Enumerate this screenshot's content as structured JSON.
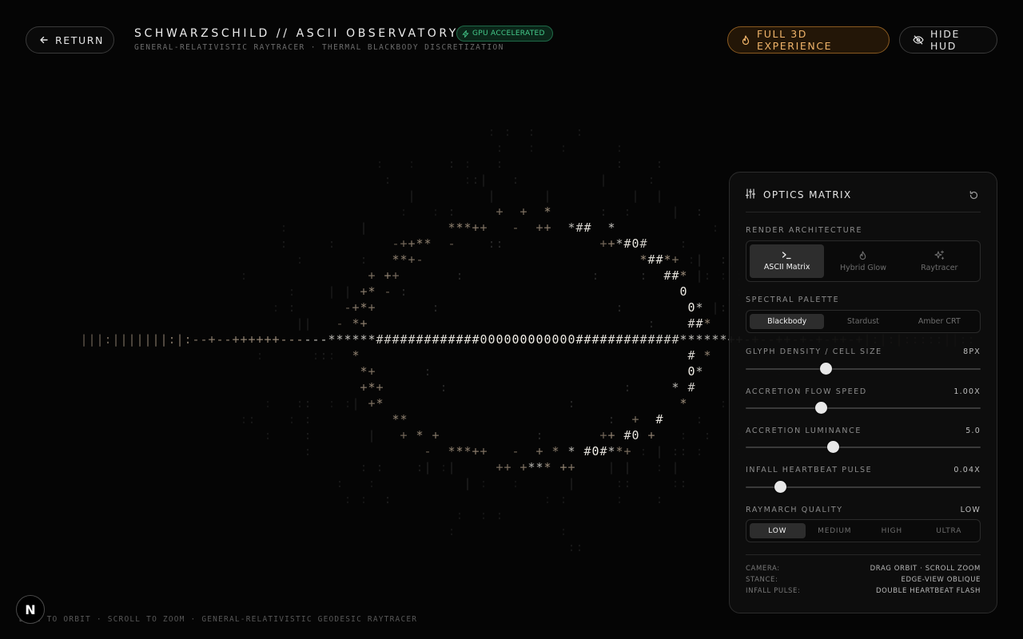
{
  "header": {
    "return_label": "RETURN",
    "title": "SCHWARZSCHILD // ASCII OBSERVATORY",
    "gpu_badge": "GPU ACCELERATED",
    "subtitle": "GENERAL-RELATIVISTIC RAYTRACER · THERMAL BLACKBODY DISCRETIZATION",
    "full3d_label": "FULL 3D EXPERIENCE",
    "hide_hud_label": "HIDE HUD"
  },
  "panel": {
    "title": "OPTICS MATRIX",
    "render_architecture": {
      "label": "RENDER ARCHITECTURE",
      "options": [
        "ASCII Matrix",
        "Hybrid Glow",
        "Raytracer"
      ],
      "selected": "ASCII Matrix"
    },
    "spectral_palette": {
      "label": "SPECTRAL PALETTE",
      "options": [
        "Blackbody",
        "Stardust",
        "Amber CRT"
      ],
      "selected": "Blackbody"
    },
    "sliders": [
      {
        "label": "GLYPH DENSITY / CELL SIZE",
        "value_text": "8PX",
        "fraction": 0.34
      },
      {
        "label": "ACCRETION FLOW SPEED",
        "value_text": "1.00X",
        "fraction": 0.32
      },
      {
        "label": "ACCRETION LUMINANCE",
        "value_text": "5.0",
        "fraction": 0.37
      },
      {
        "label": "INFALL HEARTBEAT PULSE",
        "value_text": "0.04X",
        "fraction": 0.145
      }
    ],
    "raymarch_quality": {
      "label": "RAYMARCH QUALITY",
      "value_text": "LOW",
      "options": [
        "LOW",
        "MEDIUM",
        "HIGH",
        "ULTRA"
      ],
      "selected": "LOW"
    },
    "footer": [
      {
        "key": "CAMERA:",
        "value": "DRAG ORBIT · SCROLL ZOOM"
      },
      {
        "key": "STANCE:",
        "value": "EDGE-VIEW OBLIQUE"
      },
      {
        "key": "INFALL PULSE:",
        "value": "DOUBLE HEARTBEAT FLASH"
      }
    ]
  },
  "bottom_hint": "DRAG TO ORBIT · SCROLL TO ZOOM · GENERAL-RELATIVISTIC GEODESIC RAYTRACER",
  "logo_letter": "N",
  "colors": {
    "accent_orange": "#f0b46a",
    "gpu_green": "#44c98a",
    "glyph_hot": "#f4f1ea",
    "glyph_warm": "#d8c2a8",
    "glyph_dim": "#6a6a6a"
  },
  "icons": {
    "return": "arrow-left-icon",
    "gpu": "bolt-icon",
    "full3d": "flame-icon",
    "hide_hud": "eye-off-icon",
    "panel": "sliders-icon",
    "reset": "reset-icon"
  }
}
